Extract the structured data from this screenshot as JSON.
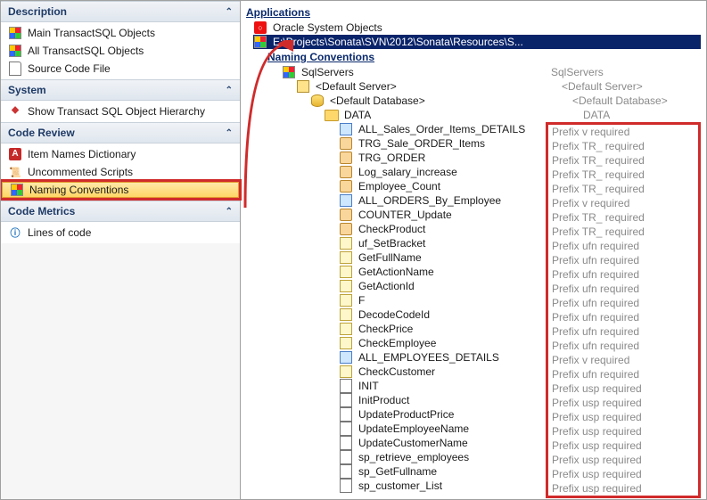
{
  "left": {
    "groups": [
      {
        "title": "Description",
        "items": [
          {
            "name": "main-tsql",
            "icon": "msgrid",
            "label": "Main TransactSQL Objects"
          },
          {
            "name": "all-tsql",
            "icon": "msgrid",
            "label": "All TransactSQL Objects"
          },
          {
            "name": "src-file",
            "icon": "file",
            "label": "Source Code File"
          }
        ]
      },
      {
        "title": "System",
        "items": [
          {
            "name": "obj-hier",
            "icon": "tree",
            "label": "Show Transact SQL Object Hierarchy"
          }
        ]
      },
      {
        "title": "Code Review",
        "items": [
          {
            "name": "names-dict",
            "icon": "A",
            "label": "Item Names Dictionary"
          },
          {
            "name": "uncommented",
            "icon": "scroll",
            "label": "Uncommented Scripts"
          },
          {
            "name": "naming-conv",
            "icon": "msgrid",
            "label": "Naming Conventions",
            "selected": true
          }
        ]
      },
      {
        "title": "Code Metrics",
        "items": [
          {
            "name": "loc",
            "icon": "info",
            "label": "Lines of code"
          }
        ]
      }
    ]
  },
  "right": {
    "applications_label": "Applications",
    "app_items": [
      {
        "icon": "oracle",
        "label": "Oracle System Objects",
        "selected": false
      },
      {
        "icon": "msgrid",
        "label": "E:\\Projects\\Sonata\\SVN\\2012\\Sonata\\Resources\\S...",
        "selected": true
      }
    ],
    "naming_label": "Naming Conventions",
    "left_tree": {
      "root": "SqlServers",
      "server": "<Default Server>",
      "db": "<Default Database>",
      "data": "DATA",
      "rows": [
        {
          "icon": "sql",
          "label": "ALL_Sales_Order_Items_DETAILS"
        },
        {
          "icon": "trg",
          "label": "TRG_Sale_ORDER_Items"
        },
        {
          "icon": "trg",
          "label": "TRG_ORDER"
        },
        {
          "icon": "trg",
          "label": "Log_salary_increase"
        },
        {
          "icon": "trg",
          "label": "Employee_Count"
        },
        {
          "icon": "sql",
          "label": "ALL_ORDERS_By_Employee"
        },
        {
          "icon": "trg",
          "label": "COUNTER_Update"
        },
        {
          "icon": "trg",
          "label": "CheckProduct"
        },
        {
          "icon": "fn",
          "label": "uf_SetBracket"
        },
        {
          "icon": "fn",
          "label": "GetFullName"
        },
        {
          "icon": "fn",
          "label": "GetActionName"
        },
        {
          "icon": "fn",
          "label": "GetActionId"
        },
        {
          "icon": "fn",
          "label": "F"
        },
        {
          "icon": "fn",
          "label": "DecodeCodeId"
        },
        {
          "icon": "fn",
          "label": "CheckPrice"
        },
        {
          "icon": "fn",
          "label": "CheckEmployee"
        },
        {
          "icon": "sql",
          "label": "ALL_EMPLOYEES_DETAILS"
        },
        {
          "icon": "fn",
          "label": "CheckCustomer"
        },
        {
          "icon": "proc",
          "label": "INIT"
        },
        {
          "icon": "proc",
          "label": "InitProduct"
        },
        {
          "icon": "proc",
          "label": "UpdateProductPrice"
        },
        {
          "icon": "proc",
          "label": "UpdateEmployeeName"
        },
        {
          "icon": "proc",
          "label": "UpdateCustomerName"
        },
        {
          "icon": "proc",
          "label": "sp_retrieve_employees"
        },
        {
          "icon": "proc",
          "label": "sp_GetFullname"
        },
        {
          "icon": "proc",
          "label": "sp_customer_List"
        }
      ]
    },
    "right_tree": {
      "root": "SqlServers",
      "server": "<Default Server>",
      "db": "<Default Database>",
      "data": "DATA",
      "msgs": [
        "Prefix v required",
        "Prefix TR_ required",
        "Prefix TR_ required",
        "Prefix TR_ required",
        "Prefix TR_ required",
        "Prefix v required",
        "Prefix TR_ required",
        "Prefix TR_ required",
        "Prefix ufn required",
        "Prefix ufn required",
        "Prefix ufn required",
        "Prefix ufn required",
        "Prefix ufn required",
        "Prefix ufn required",
        "Prefix ufn required",
        "Prefix ufn required",
        "Prefix v required",
        "Prefix ufn required",
        "Prefix usp required",
        "Prefix usp required",
        "Prefix usp required",
        "Prefix usp required",
        "Prefix usp required",
        "Prefix usp required",
        "Prefix usp required",
        "Prefix usp required"
      ]
    }
  }
}
